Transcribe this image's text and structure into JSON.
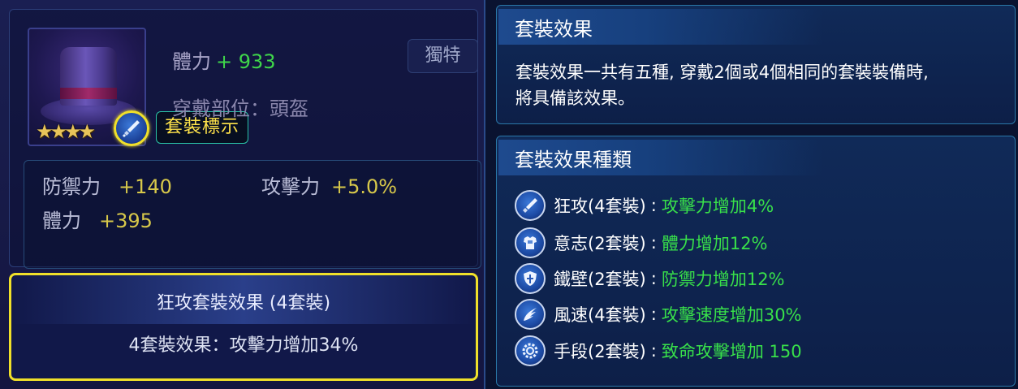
{
  "item": {
    "stars": "★★★★",
    "hp_label": "體力",
    "hp_value": "+ 933",
    "slot_label": "穿戴部位：頭盔",
    "unique_label": "獨特",
    "set_tag": "套裝標示",
    "bonuses": [
      {
        "label": "防禦力",
        "value": "+140"
      },
      {
        "label": "攻擊力",
        "value": "+5.0%"
      },
      {
        "label": "體力",
        "value": "+395"
      }
    ]
  },
  "set_effect": {
    "title": "狂攻套裝效果 (4套裝)",
    "description": "4套裝效果：攻擊力增加34%"
  },
  "info": {
    "title": "套裝效果",
    "line1": "套裝效果一共有五種, 穿戴2個或4個相同的套裝裝備時,",
    "line2": "將具備該效果。"
  },
  "types": {
    "title": "套裝效果種類",
    "items": [
      {
        "icon": "sword-icon",
        "name": "狂攻(4套裝)",
        "effect": "攻擊力增加4%"
      },
      {
        "icon": "armor-icon",
        "name": "意志(2套裝)",
        "effect": "體力增加12%"
      },
      {
        "icon": "shield-icon",
        "name": "鐵壁(2套裝)",
        "effect": "防禦力增加12%"
      },
      {
        "icon": "wing-icon",
        "name": "風速(4套裝)",
        "effect": "攻擊速度增加30%"
      },
      {
        "icon": "gear-icon",
        "name": "手段(2套裝)",
        "effect": "致命攻擊增加 150"
      }
    ]
  },
  "colors": {
    "accent_yellow": "#f0e02a",
    "green_value": "#3fd64a",
    "bonus_value": "#d7c84a"
  }
}
